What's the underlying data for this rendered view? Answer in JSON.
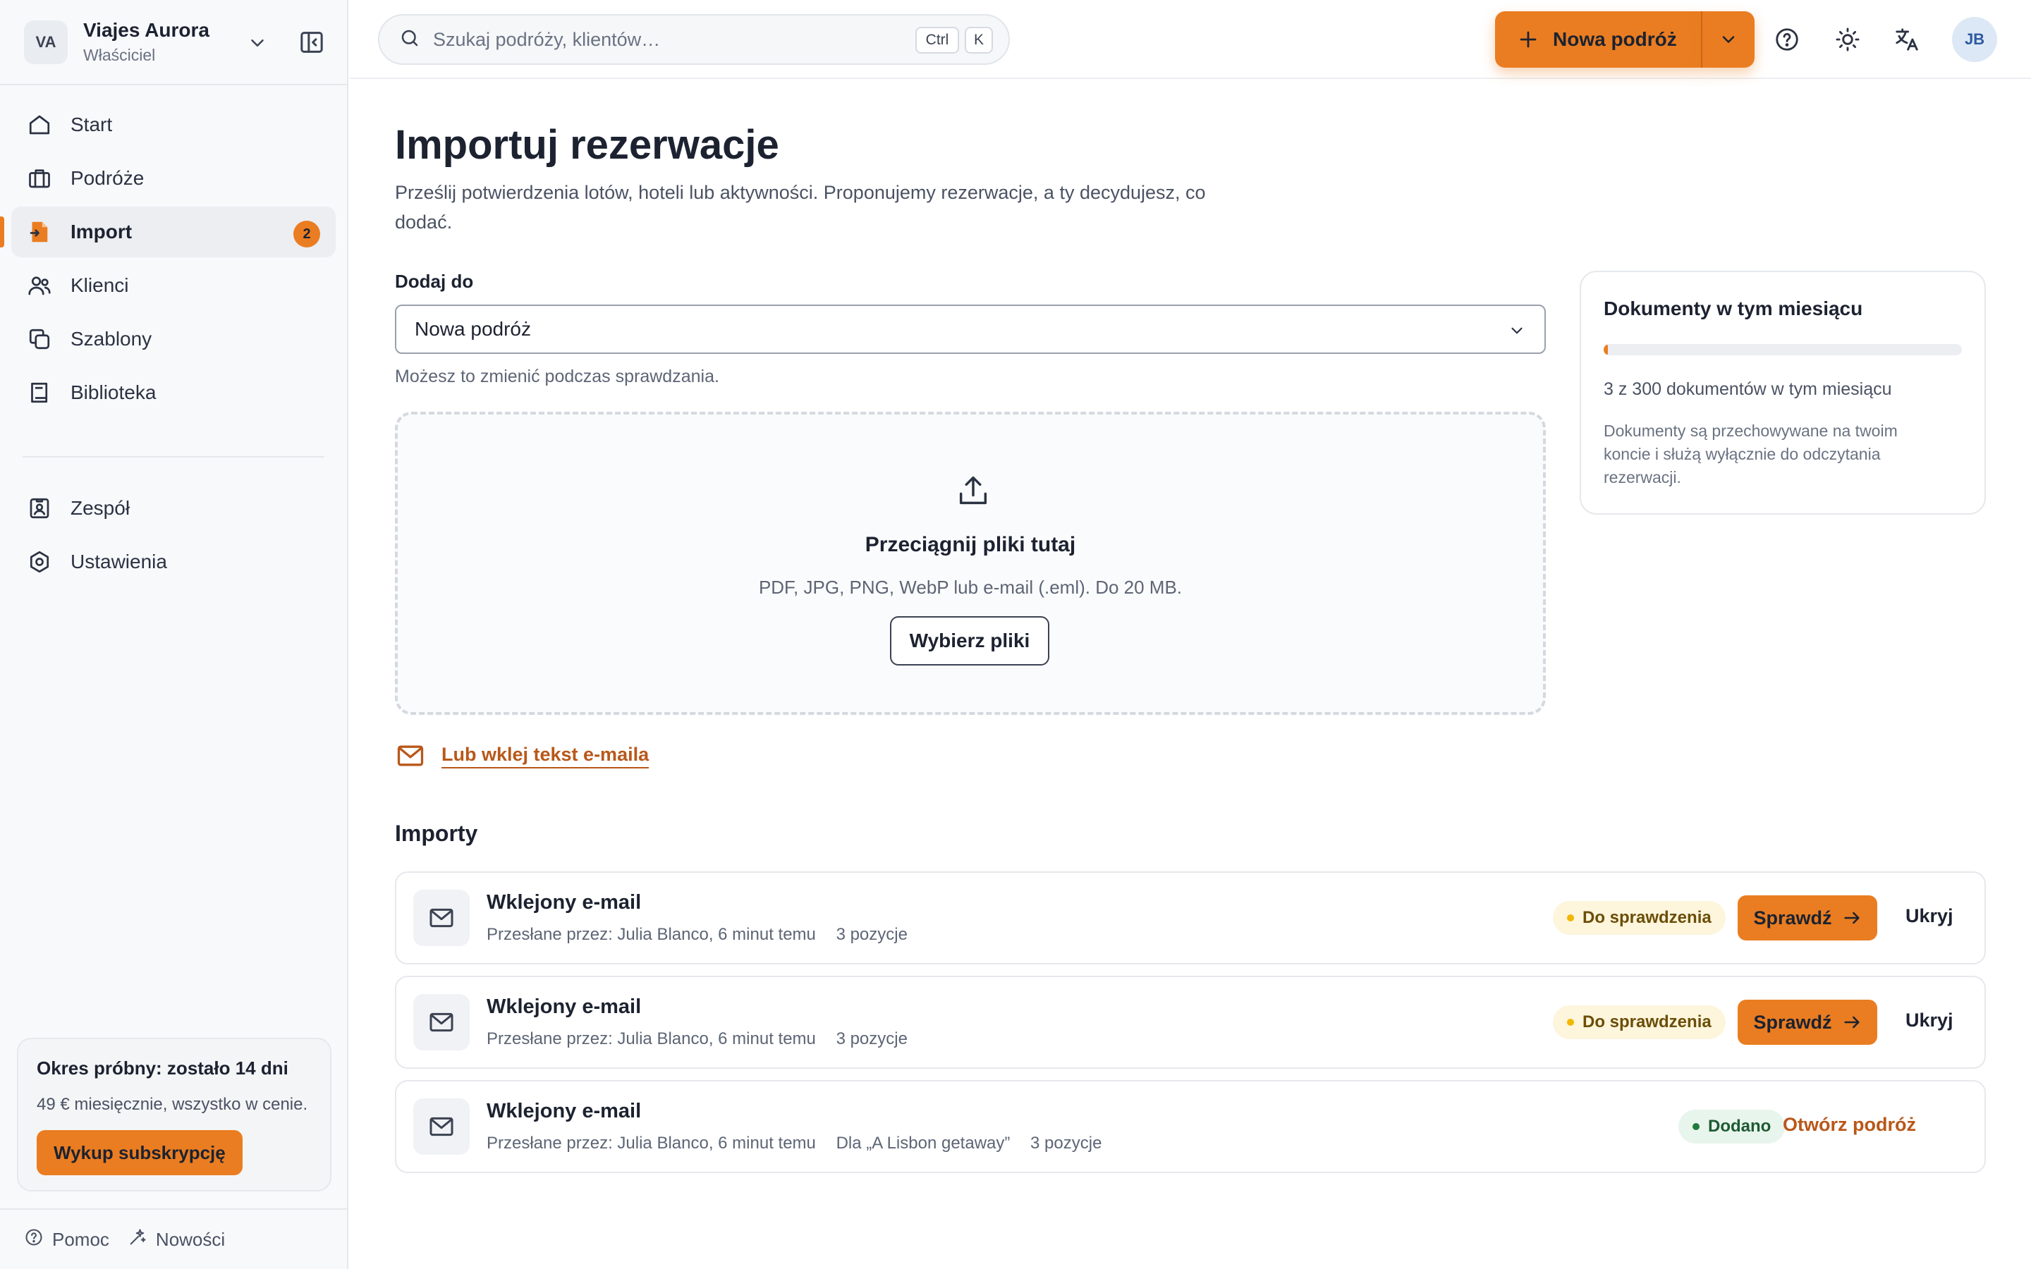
{
  "workspace": {
    "initials": "VA",
    "name": "Viajes Aurora",
    "role": "Właściciel"
  },
  "nav": {
    "items": [
      {
        "label": "Start",
        "icon": "home-icon"
      },
      {
        "label": "Podróże",
        "icon": "briefcase-icon"
      },
      {
        "label": "Import",
        "icon": "import-file-icon",
        "badge": "2",
        "active": true
      },
      {
        "label": "Klienci",
        "icon": "users-icon"
      },
      {
        "label": "Szablony",
        "icon": "copy-icon"
      },
      {
        "label": "Biblioteka",
        "icon": "book-icon"
      }
    ],
    "secondary": [
      {
        "label": "Zespół",
        "icon": "team-badge-icon"
      },
      {
        "label": "Ustawienia",
        "icon": "gear-icon"
      }
    ]
  },
  "trial": {
    "title": "Okres próbny: zostało 14 dni",
    "price": "49 € miesięcznie, wszystko w cenie.",
    "button": "Wykup subskrypcję"
  },
  "footer": {
    "help": "Pomoc",
    "news": "Nowości"
  },
  "topbar": {
    "search_placeholder": "Szukaj podróży, klientów…",
    "kbd_ctrl": "Ctrl",
    "kbd_k": "K",
    "new_trip": "Nowa podróż",
    "user_initials": "JB"
  },
  "page": {
    "title": "Importuj rezerwacje",
    "subtitle": "Prześlij potwierdzenia lotów, hoteli lub aktywności. Proponujemy rezerwacje, a ty decydujesz, co dodać.",
    "add_to_label": "Dodaj do",
    "add_to_value": "Nowa podróż",
    "add_to_hint": "Możesz to zmienić podczas sprawdzania.",
    "dropzone": {
      "title": "Przeciągnij pliki tutaj",
      "types": "PDF, JPG, PNG, WebP lub e-mail (.eml). Do 20 MB.",
      "button": "Wybierz pliki"
    },
    "paste_link": "Lub wklej tekst e-maila"
  },
  "usage": {
    "title": "Dokumenty w tym miesiącu",
    "used": 3,
    "limit": 300,
    "count_text": "3 z 300 dokumentów w tym miesiącu",
    "note": "Dokumenty są przechowywane na twoim koncie i służą wyłącznie do odczytania rezerwacji."
  },
  "imports": {
    "title": "Importy",
    "rows": [
      {
        "title": "Wklejony e-mail",
        "meta": "Przesłane przez: Julia Blanco, 6 minut temu",
        "trip": "",
        "items": "3 pozycje",
        "status": "Do sprawdzenia",
        "review": "Sprawdź",
        "hide": "Ukryj"
      },
      {
        "title": "Wklejony e-mail",
        "meta": "Przesłane przez: Julia Blanco, 6 minut temu",
        "trip": "",
        "items": "3 pozycje",
        "status": "Do sprawdzenia",
        "review": "Sprawdź",
        "hide": "Ukryj"
      },
      {
        "title": "Wklejony e-mail",
        "meta": "Przesłane przez: Julia Blanco, 6 minut temu",
        "trip": "Dla „A Lisbon getaway”",
        "items": "3 pozycje",
        "status": "Dodano",
        "open": "Otwórz podróż"
      }
    ]
  },
  "colors": {
    "accent": "#ea7d21",
    "link": "#b8581a",
    "review_dot": "#f2b705",
    "added_dot": "#1f7a3e"
  }
}
